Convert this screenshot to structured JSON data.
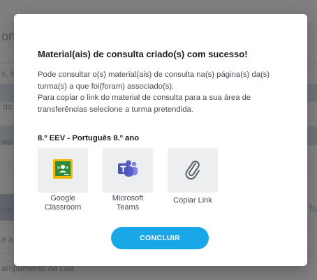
{
  "background": {
    "fragments": [
      "ort",
      "s, in",
      "da",
      "vid",
      "tur",
      "To",
      "e a",
      "ampamento na Lua"
    ]
  },
  "modal": {
    "title": "Material(ais) de consulta criado(s) com sucesso!",
    "paragraph_1": "Pode consultar o(s) material(ais) de consulta na(s) página(s) da(s) turma(s) a que foi(foram) associado(s).",
    "paragraph_2": "Para copiar o link do material de consulta para a sua área de transferências selecione a turma pretendida.",
    "class_name": "8.º EEV - Português 8.º ano",
    "options": [
      {
        "label_line1": "Google",
        "label_line2": "Classroom",
        "icon": "google-classroom-icon"
      },
      {
        "label_line1": "Microsoft",
        "label_line2": "Teams",
        "icon": "microsoft-teams-icon"
      },
      {
        "label_line1": "Copiar Link",
        "label_line2": "",
        "icon": "paperclip-icon"
      }
    ],
    "confirm_label": "CONCLUIR"
  },
  "colors": {
    "accent": "#1aa7e8",
    "classroom_green": "#2e8b3a",
    "classroom_yellow": "#f5b800",
    "teams_purple": "#5b5fc7"
  }
}
